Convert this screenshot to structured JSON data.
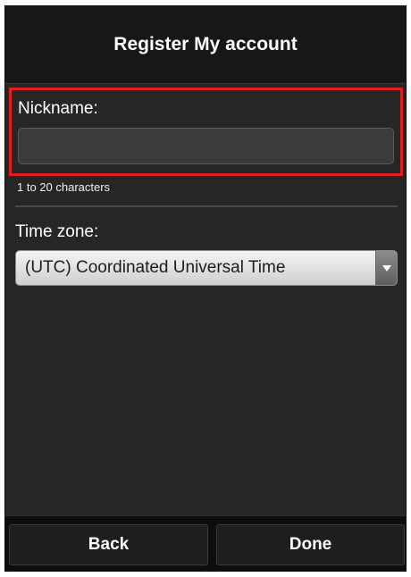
{
  "header": {
    "title": "Register My account"
  },
  "nickname": {
    "label": "Nickname:",
    "value": "",
    "placeholder": "",
    "hint": "1 to 20 characters",
    "highlight_color": "#e01e1e"
  },
  "timezone": {
    "label": "Time zone:",
    "selected": "(UTC) Coordinated Universal Time",
    "arrow_icon": "chevron-down-icon"
  },
  "footer": {
    "back_label": "Back",
    "done_label": "Done"
  }
}
